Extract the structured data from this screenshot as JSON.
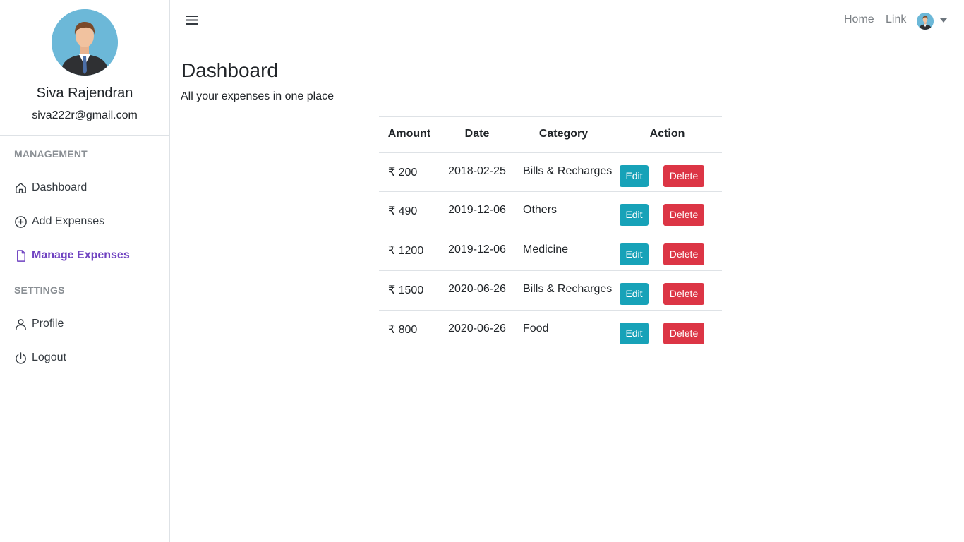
{
  "sidebar": {
    "user_name": "Siva Rajendran",
    "user_email": "siva222r@gmail.com",
    "management_heading": "MANAGEMENT",
    "settings_heading": "SETTINGS",
    "items": [
      {
        "label": "Dashboard",
        "icon": "home-icon"
      },
      {
        "label": "Add Expenses",
        "icon": "plus-circle-icon"
      },
      {
        "label": "Manage Expenses",
        "icon": "file-icon",
        "active": true
      },
      {
        "label": "Profile",
        "icon": "user-icon"
      },
      {
        "label": "Logout",
        "icon": "power-icon"
      }
    ]
  },
  "topbar": {
    "home_label": "Home",
    "link_label": "Link"
  },
  "main": {
    "title": "Dashboard",
    "subtitle": "All your expenses in one place"
  },
  "table": {
    "headers": {
      "amount": "Amount",
      "date": "Date",
      "category": "Category",
      "action": "Action"
    },
    "edit_label": "Edit",
    "delete_label": "Delete",
    "rows": [
      {
        "amount": "₹ 200",
        "date": "2018-02-25",
        "category": "Bills & Recharges"
      },
      {
        "amount": "₹ 490",
        "date": "2019-12-06",
        "category": "Others"
      },
      {
        "amount": "₹ 1200",
        "date": "2019-12-06",
        "category": "Medicine"
      },
      {
        "amount": "₹ 1500",
        "date": "2020-06-26",
        "category": "Bills & Recharges"
      },
      {
        "amount": "₹ 800",
        "date": "2020-06-26",
        "category": "Food"
      }
    ]
  },
  "colors": {
    "accent": "#6f42c1",
    "edit": "#17a2b8",
    "delete": "#dc3545"
  }
}
